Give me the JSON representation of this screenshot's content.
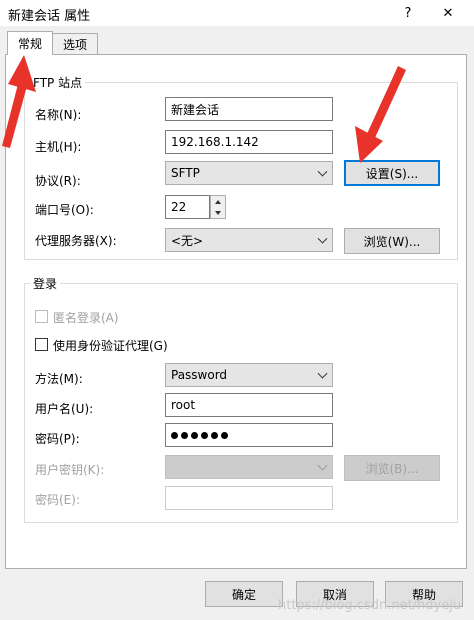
{
  "window": {
    "title": "新建会话 属性",
    "help_glyph": "?",
    "close_glyph": "✕"
  },
  "tabs": [
    {
      "label": "常规",
      "active": true
    },
    {
      "label": "选项",
      "active": false
    }
  ],
  "ftp_site": {
    "group_label": "FTP 站点",
    "name": {
      "label": "名称(N):",
      "value": "新建会话"
    },
    "host": {
      "label": "主机(H):",
      "value": "192.168.1.142"
    },
    "protocol": {
      "label": "协议(R):",
      "value": "SFTP",
      "settings_button": "设置(S)..."
    },
    "port": {
      "label": "端口号(O):",
      "value": "22"
    },
    "proxy": {
      "label": "代理服务器(X):",
      "value": "<无>",
      "browse_button": "浏览(W)..."
    }
  },
  "login": {
    "group_label": "登录",
    "anonymous": {
      "label": "匿名登录(A)",
      "checked": false,
      "enabled": false
    },
    "use_agent": {
      "label": "使用身份验证代理(G)",
      "checked": false,
      "enabled": true
    },
    "method": {
      "label": "方法(M):",
      "value": "Password"
    },
    "username": {
      "label": "用户名(U):",
      "value": "root"
    },
    "password": {
      "label": "密码(P):",
      "masked_length": 6
    },
    "user_key": {
      "label": "用户密钥(K):",
      "value": "",
      "browse_button": "浏览(B)..."
    },
    "passphrase": {
      "label": "密码(E):",
      "value": ""
    }
  },
  "footer": {
    "ok": "确定",
    "cancel": "取消",
    "help": "帮助",
    "watermark": "https://blog.csdn.net/hdyeju"
  },
  "colors": {
    "annotation_arrow": "#e8332a",
    "focus_border": "#0078d7"
  }
}
